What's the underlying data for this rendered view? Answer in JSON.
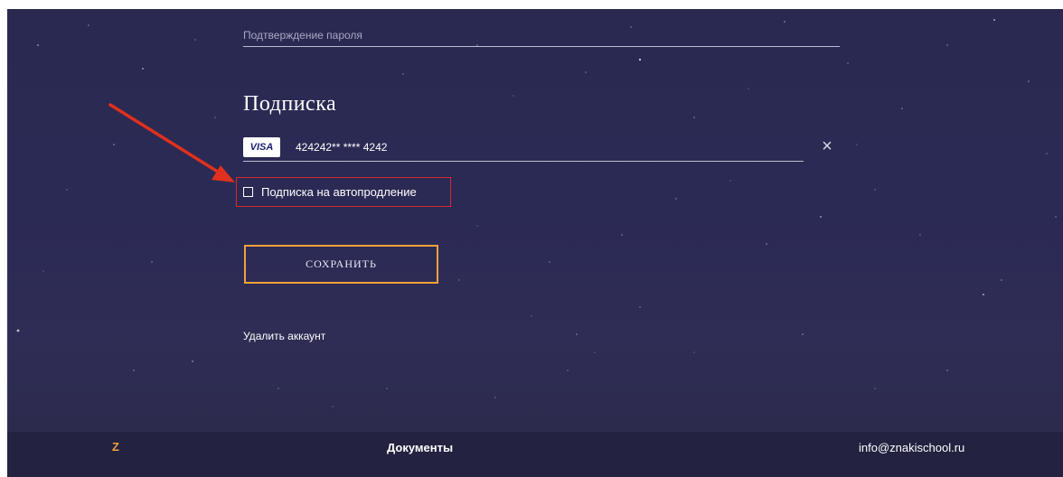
{
  "form": {
    "confirm_password_placeholder": "Подтверждение пароля"
  },
  "subscription": {
    "title": "Подписка",
    "card_brand": "VISA",
    "card_number": "424242** **** 4242",
    "clear_icon": "×",
    "autorenew_label": "Подписка на автопродление",
    "autorenew_checked": false
  },
  "actions": {
    "save_label": "СОХРАНИТЬ",
    "delete_account_label": "Удалить аккаунт"
  },
  "footer": {
    "logo_glyph": "Z",
    "documents_label": "Документы",
    "email": "info@znakischool.ru"
  },
  "colors": {
    "background": "#2b2a55",
    "accent": "#f0a23a",
    "annotation": "#d12b2b",
    "visa_blue": "#1a1f71"
  },
  "icons": [
    "close-icon",
    "checkbox-icon",
    "visa-logo-icon",
    "annotation-arrow-icon"
  ]
}
